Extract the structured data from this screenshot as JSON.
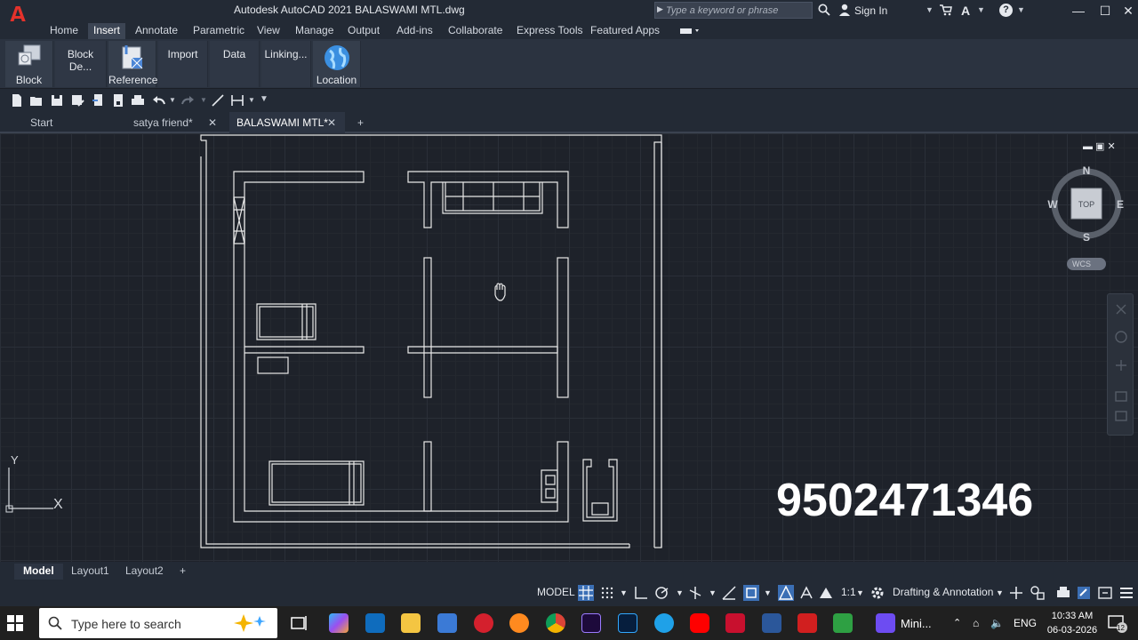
{
  "titlebar": {
    "window_title": "Autodesk AutoCAD 2021    BALASWAMI  MTL.dwg",
    "search_placeholder": "Type a keyword or phrase",
    "sign_in": "Sign In",
    "minimize": "—",
    "maximize": "☐",
    "close": "✕"
  },
  "ribbon_tabs": [
    "Home",
    "Insert",
    "Annotate",
    "Parametric",
    "View",
    "Manage",
    "Output",
    "Add-ins",
    "Collaborate",
    "Express Tools",
    "Featured Apps"
  ],
  "ribbon_active_tab": "Insert",
  "ribbon_buttons": {
    "block": "Block",
    "block_definition": "Block De...",
    "reference": "Reference",
    "import": "Import",
    "data": "Data",
    "linking": "Linking...",
    "location": "Location"
  },
  "file_tabs": {
    "start": "Start",
    "doc1": "satya friend*",
    "doc2": "BALASWAMI  MTL*",
    "new": "+"
  },
  "viewport": {
    "controls": "▬ ▣ ✕",
    "compass": {
      "n": "N",
      "s": "S",
      "e": "E",
      "w": "W",
      "face": "TOP"
    },
    "wcs": "WCS",
    "ucs_x": "X",
    "ucs_y": "Y"
  },
  "overlay_phone": "9502471346",
  "layout_tabs": [
    "Model",
    "Layout1",
    "Layout2",
    "+"
  ],
  "statusbar": {
    "model": "MODEL",
    "scale": "1:1",
    "workspace": "Drafting & Annotation"
  },
  "taskbar": {
    "search_text": "Type here to search",
    "mini_label": "Mini...",
    "lang": "ENG",
    "time": "10:33 AM",
    "date": "06-03-2026",
    "notifications": "12"
  },
  "colors": {
    "acad_red": "#e4322b",
    "canvas_bg": "#1e222a",
    "line_white": "#e8e8e8"
  }
}
